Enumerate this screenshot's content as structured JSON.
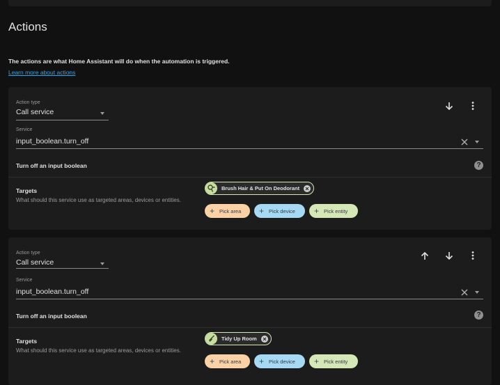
{
  "section": {
    "title": "Actions",
    "intro": "The actions are what Home Assistant will do when the automation is triggered.",
    "learn_more": "Learn more about actions"
  },
  "actions": [
    {
      "action_type_label": "Action type",
      "action_type_value": "Call service",
      "service_label": "Service",
      "service_value": "input_boolean.turn_off",
      "service_description": "Turn off an input boolean",
      "targets_title": "Targets",
      "targets_help": "What should this service use as targeted areas, devices or entities.",
      "entity_chip": "Brush Hair & Put On Deodorant",
      "pick_area": "Pick area",
      "pick_device": "Pick device",
      "pick_entity": "Pick entity"
    },
    {
      "action_type_label": "Action type",
      "action_type_value": "Call service",
      "service_label": "Service",
      "service_value": "input_boolean.turn_off",
      "service_description": "Turn off an input boolean",
      "targets_title": "Targets",
      "targets_help": "What should this service use as targeted areas, devices or entities.",
      "entity_chip": "Tidy Up Room",
      "pick_area": "Pick area",
      "pick_device": "Pick device",
      "pick_entity": "Pick entity"
    }
  ],
  "icons": {
    "move_up": "arrow-up-icon",
    "move_down": "arrow-down-icon",
    "menu": "dots-vertical-icon",
    "clear": "close-icon",
    "dropdown": "menu-down-icon",
    "help": "help-circle-icon",
    "entity_1": "hair-dryer-icon",
    "entity_2": "broom-icon",
    "remove": "close-circle-icon",
    "plus": "plus-icon"
  },
  "colors": {
    "background": "#111111",
    "card": "#1c1c1c",
    "link": "#2fa6e8",
    "area_chip": "#fcd1a6",
    "device_chip": "#a6daf4",
    "entity_chip": "#d3e8b6"
  }
}
